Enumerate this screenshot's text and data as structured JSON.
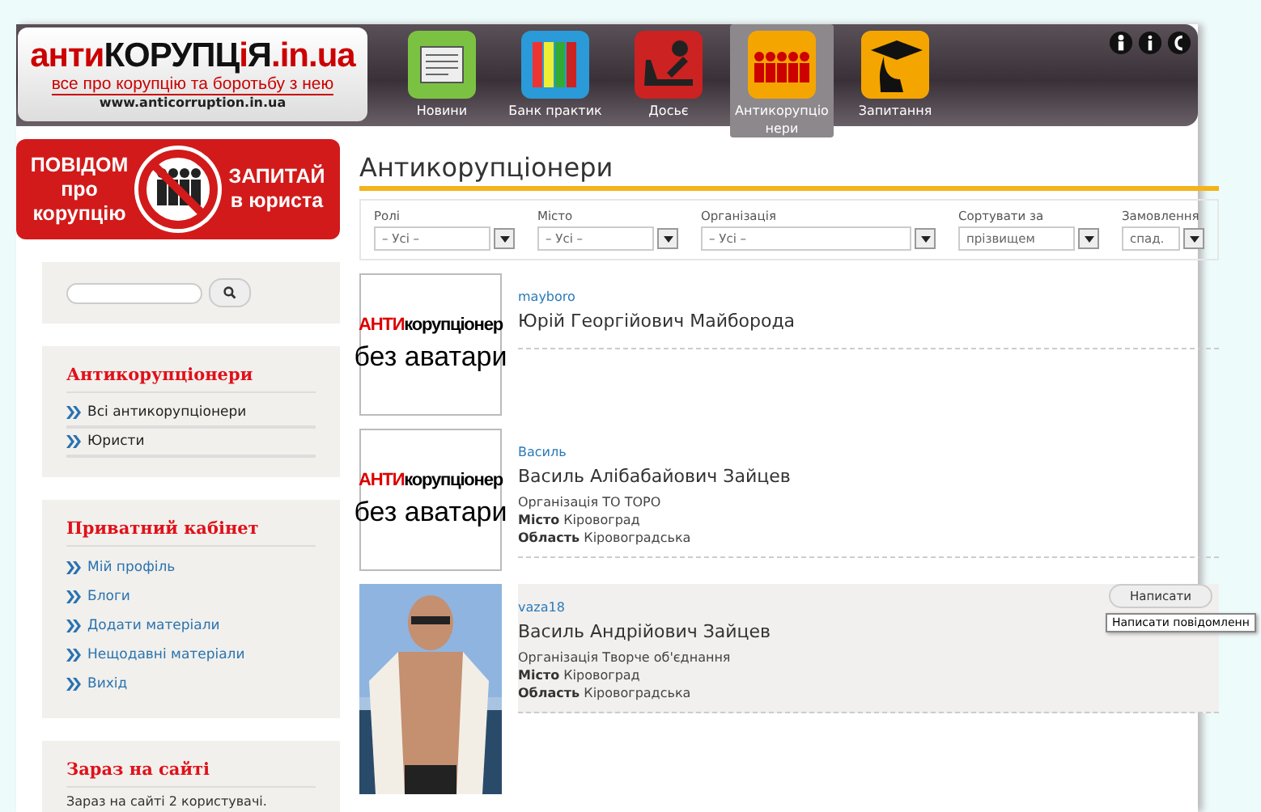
{
  "logo": {
    "parts": [
      {
        "text": "анти",
        "color": "#cc0000"
      },
      {
        "text": "КОРУПЦ",
        "color": "#111111"
      },
      {
        "text": "і",
        "color": "#cc0000"
      },
      {
        "text": "Я",
        "color": "#111111"
      },
      {
        "text": ".in.ua",
        "color": "#cc0000"
      }
    ],
    "tagline": "все про корупцію та боротьбу з нею",
    "url": "www.anticorruption.in.ua"
  },
  "nav": [
    {
      "label": "Новини",
      "kind": "news",
      "selected": false
    },
    {
      "label": "Банк практик",
      "kind": "folders",
      "selected": false
    },
    {
      "label": "Досьє",
      "kind": "dossier",
      "selected": false
    },
    {
      "label": "Антикорупціо нери",
      "kind": "people",
      "selected": true
    },
    {
      "label": "Запитання",
      "kind": "graduate",
      "selected": false
    }
  ],
  "banner": {
    "left": "ПОВІДОМ про корупцію",
    "right": "ЗАПИТАЙ в юриста"
  },
  "sidebar": [
    {
      "kind": "search"
    },
    {
      "kind": "menu",
      "title": "Антикорупціонери",
      "items": [
        "Всі антикорупціонери",
        "Юристи"
      ],
      "dark": true
    },
    {
      "kind": "menu",
      "title": "Приватний кабінет",
      "items": [
        "Мій профіль",
        "Блоги",
        "Додати матеріали",
        "Нещодавні матеріали",
        "Вихід"
      ],
      "dark": false
    },
    {
      "kind": "text",
      "title": "Зараз на сайті",
      "text": "Зараз на сайті 2 користувачі."
    }
  ],
  "page_title": "Антикорупціонери",
  "filters": [
    {
      "label": "Ролі",
      "value": "– Усі –"
    },
    {
      "label": "Місто",
      "value": "– Усі –"
    },
    {
      "label": "Організація",
      "value": "– Усі –"
    },
    {
      "label": "Сортувати за",
      "value": "прізвищем"
    },
    {
      "label": "Замовлення",
      "value": "спад."
    }
  ],
  "members": [
    {
      "username": "mayboro",
      "name": "Юрій Георгійович Майборода",
      "avatar": {
        "kind": "placeholder",
        "red": "АНТИ",
        "rest": "корупціонер",
        "line2": "без аватари"
      },
      "highlighted": false
    },
    {
      "username": "Василь",
      "name": "Василь Алібабайович Зайцев",
      "avatar": {
        "kind": "placeholder",
        "red": "АНТИ",
        "rest": "корупціонер",
        "line2": "без аватари"
      },
      "details": [
        {
          "label": "Організація",
          "value": "ТО ТОРО",
          "bold": false
        },
        {
          "label": "Місто",
          "value": "Кіровоград",
          "bold": true
        },
        {
          "label": "Область",
          "value": "Кіровоградська",
          "bold": true
        }
      ],
      "highlighted": false
    },
    {
      "username": "vaza18",
      "name": "Василь Андрійович Зайцев",
      "avatar": {
        "kind": "picture"
      },
      "details": [
        {
          "label": "Організація",
          "value": "Творче об'єднання",
          "bold": false
        },
        {
          "label": "Місто",
          "value": "Кіровоград",
          "bold": true
        },
        {
          "label": "Область",
          "value": "Кіровоградська",
          "bold": true
        }
      ],
      "highlighted": true,
      "button": "Написати",
      "tooltip": "Написати повідомленн"
    }
  ]
}
